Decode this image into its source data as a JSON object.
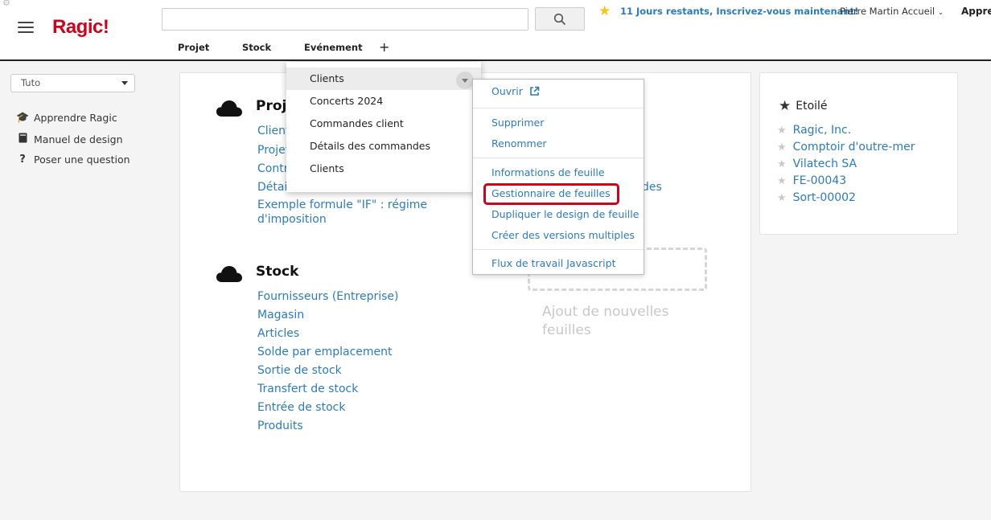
{
  "header": {
    "logo": "Ragic!",
    "search": {
      "value": "",
      "placeholder": ""
    },
    "trial_text": "11 Jours restants, Inscrivez-vous maintenant!",
    "user_menu": "Pierre Martin Accueil",
    "learn_truncated": "Appren",
    "tabs": [
      {
        "label": "Projet"
      },
      {
        "label": "Stock"
      },
      {
        "label": "Evénement"
      }
    ]
  },
  "sidebar": {
    "select_value": "Tuto",
    "items": [
      {
        "label": "Apprendre Ragic",
        "icon": "graduation-cap-icon"
      },
      {
        "label": "Manuel de design",
        "icon": "book-icon"
      },
      {
        "label": "Poser une question",
        "icon": "question-icon"
      }
    ]
  },
  "main": {
    "sections": [
      {
        "title": "Proje",
        "links": [
          "Clients",
          "Projet",
          "Contra",
          "Détails",
          "Exemple formule \"IF\" : régime",
          "d'imposition"
        ],
        "right_fragment": "des"
      },
      {
        "title": "Stock",
        "links": [
          "Fournisseurs (Entreprise)",
          "Magasin",
          "Articles",
          "Solde par emplacement",
          "Sortie de stock",
          "Transfert de stock",
          "Entrée de stock",
          "Produits"
        ]
      }
    ],
    "add_sheets": {
      "line1": "Ajout de nouvelles",
      "line2": "feuilles"
    }
  },
  "tab_menu": {
    "items": [
      "Clients",
      "Concerts 2024",
      "Commandes client",
      "Détails des commandes",
      "Clients"
    ]
  },
  "context_menu": {
    "open_label": "Ouvrir",
    "group1": [
      "Supprimer",
      "Renommer"
    ],
    "group2": [
      "Informations de feuille",
      "Gestionnaire de feuilles",
      "Dupliquer le design de feuille",
      "Créer des versions multiples"
    ],
    "group3": [
      "Flux de travail Javascript"
    ]
  },
  "starred": {
    "title": "Etoilé",
    "items": [
      "Ragic, Inc.",
      "Comptoir d'outre-mer",
      "Vilatech SA",
      "FE-00043",
      "Sort-00002"
    ]
  },
  "colors": {
    "brand": "#d0021b",
    "link": "#2b7bbd",
    "highlight": "#d0021b"
  }
}
